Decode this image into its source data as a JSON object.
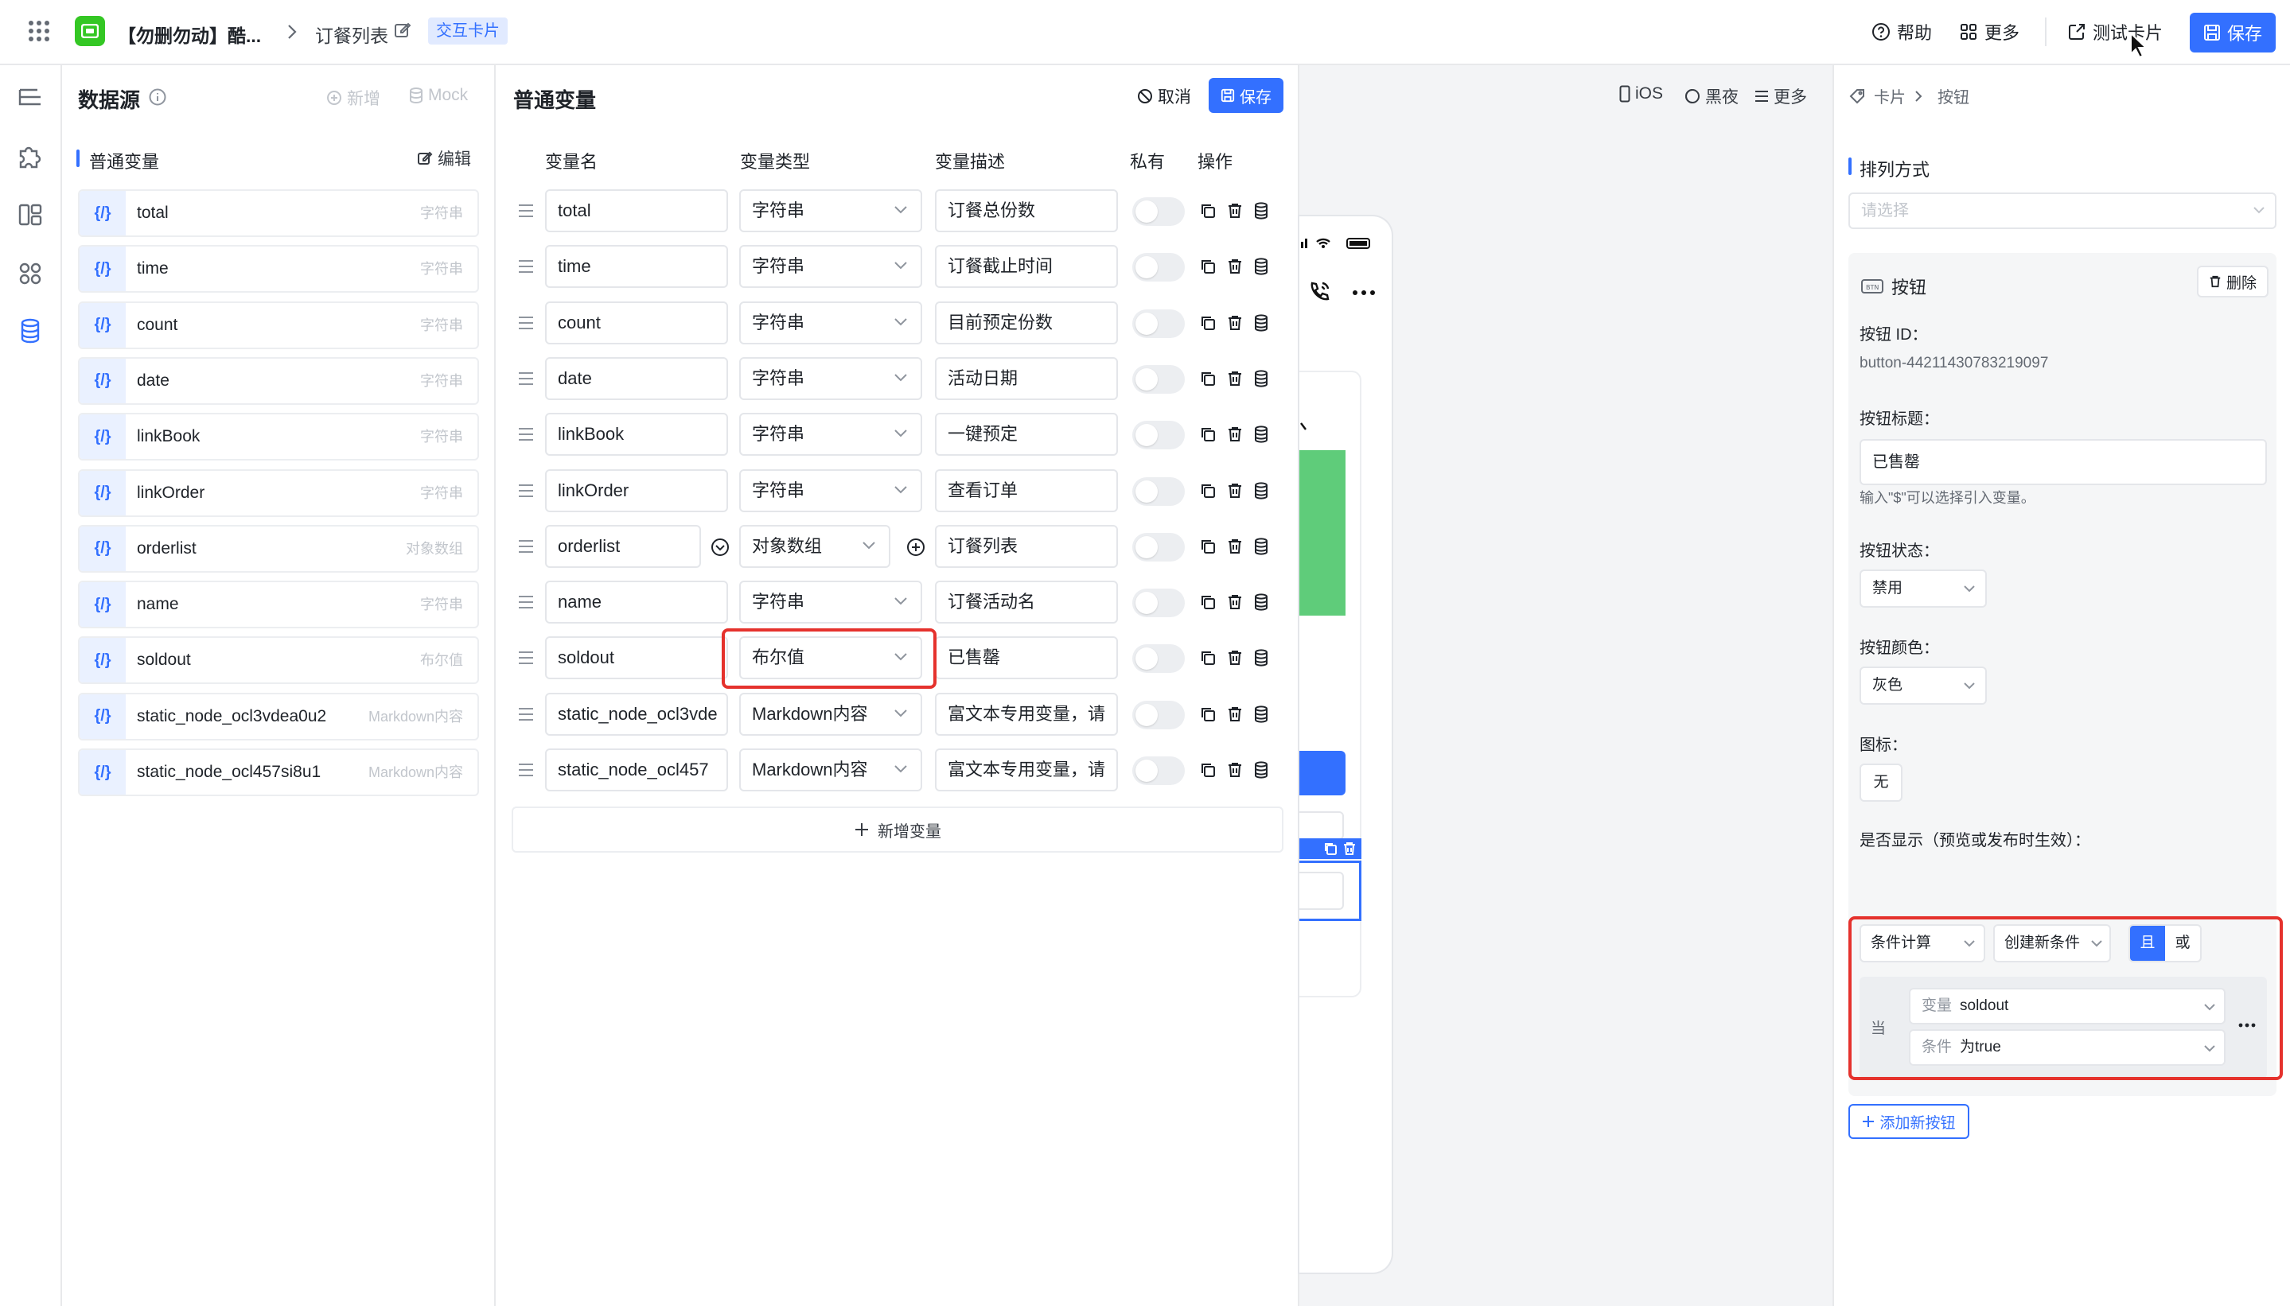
{
  "topbar": {
    "title": "【勿删勿动】酷...",
    "breadcrumb_sep": ">",
    "page": "订餐列表",
    "tag": "交互卡片",
    "help": "帮助",
    "more": "更多",
    "test_card": "测试卡片",
    "save": "保存"
  },
  "datasource": {
    "title": "数据源",
    "add": "新增",
    "mock": "Mock",
    "section": "普通变量",
    "edit": "编辑",
    "badge": "{/}",
    "items": [
      {
        "name": "total",
        "type": "字符串"
      },
      {
        "name": "time",
        "type": "字符串"
      },
      {
        "name": "count",
        "type": "字符串"
      },
      {
        "name": "date",
        "type": "字符串"
      },
      {
        "name": "linkBook",
        "type": "字符串"
      },
      {
        "name": "linkOrder",
        "type": "字符串"
      },
      {
        "name": "orderlist",
        "type": "对象数组"
      },
      {
        "name": "name",
        "type": "字符串"
      },
      {
        "name": "soldout",
        "type": "布尔值"
      },
      {
        "name": "static_node_ocl3vdea0u2",
        "type": "Markdown内容"
      },
      {
        "name": "static_node_ocl457si8u1",
        "type": "Markdown内容"
      }
    ]
  },
  "vars": {
    "title": "普通变量",
    "cancel": "取消",
    "save": "保存",
    "headers": {
      "name": "变量名",
      "type": "变量类型",
      "desc": "变量描述",
      "private": "私有",
      "ops": "操作"
    },
    "rows": [
      {
        "name": "total",
        "type": "字符串",
        "desc": "订餐总份数"
      },
      {
        "name": "time",
        "type": "字符串",
        "desc": "订餐截止时间"
      },
      {
        "name": "count",
        "type": "字符串",
        "desc": "目前预定份数"
      },
      {
        "name": "date",
        "type": "字符串",
        "desc": "活动日期"
      },
      {
        "name": "linkBook",
        "type": "字符串",
        "desc": "一键预定"
      },
      {
        "name": "linkOrder",
        "type": "字符串",
        "desc": "查看订单"
      },
      {
        "name": "orderlist",
        "type": "对象数组",
        "desc": "订餐列表"
      },
      {
        "name": "name",
        "type": "字符串",
        "desc": "订餐活动名"
      },
      {
        "name": "soldout",
        "type": "布尔值",
        "desc": "已售罄"
      },
      {
        "name": "static_node_ocl3vde",
        "type": "Markdown内容",
        "desc": "富文本专用变量，请"
      },
      {
        "name": "static_node_ocl457",
        "type": "Markdown内容",
        "desc": "富文本专用变量，请"
      }
    ],
    "add_var": "新增变量"
  },
  "preview": {
    "ios": "iOS",
    "dark": "黑夜",
    "more": "更多"
  },
  "props": {
    "crumb_card": "卡片",
    "crumb_button": "按钮",
    "sort_title": "排列方式",
    "sort_placeholder": "请选择",
    "button_section": "按钮",
    "delete": "删除",
    "button_id_label": "按钮 ID：",
    "button_id": "button-44211430783219097",
    "button_title_label": "按钮标题：",
    "button_title": "已售罄",
    "hint": "输入\"$\"可以选择引入变量。",
    "state_label": "按钮状态：",
    "state": "禁用",
    "color_label": "按钮颜色：",
    "color": "灰色",
    "icon_label": "图标：",
    "icon": "无",
    "show_label": "是否显示（预览或发布时生效）：",
    "cond_calc": "条件计算",
    "new_cond": "创建新条件",
    "and": "且",
    "or": "或",
    "when": "当",
    "var_prefix": "变量",
    "var_value": "soldout",
    "cond_prefix": "条件",
    "cond_value": "为true",
    "add_button": "添加新按钮"
  },
  "colors": {
    "accent": "#3370ff",
    "highlight": "#e5322d",
    "preview_green": "#5fcc7a"
  }
}
